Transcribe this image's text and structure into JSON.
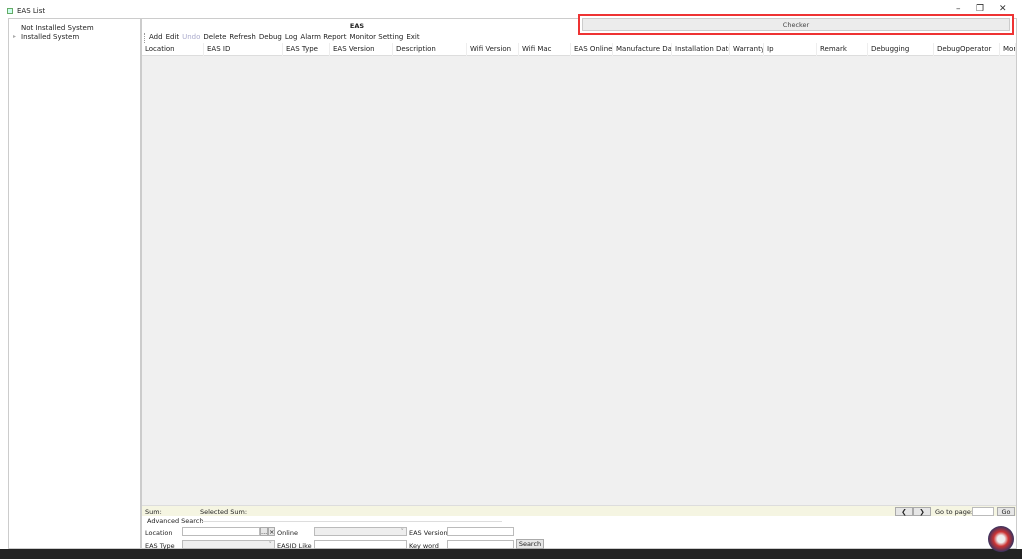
{
  "window": {
    "title": "EAS List",
    "minimize": "–",
    "restore": "❐",
    "close": "✕"
  },
  "tree": {
    "items": [
      {
        "label": "Not Installed System"
      },
      {
        "label": "Installed System",
        "expander": "▸"
      }
    ]
  },
  "main": {
    "title": "EAS",
    "checker_label": "Checker",
    "toolbar": [
      "Add",
      "Edit",
      "Undo",
      "Delete",
      "Refresh",
      "Debug",
      "Log",
      "Alarm Report",
      "Monitor Setting",
      "Exit"
    ],
    "columns": [
      "Location",
      "EAS ID",
      "EAS Type",
      "EAS Version",
      "Description",
      "Wifi Version",
      "Wifi Mac",
      "EAS Online",
      "Manufacture Date",
      "Installation Date",
      "Warranty",
      "Ip",
      "Remark",
      "Debugging",
      "DebugOperator",
      "Mor"
    ]
  },
  "status": {
    "sum": "Sum:",
    "selected_sum": "Selected Sum:",
    "prev": "❮",
    "next": "❯",
    "goto_label": "Go to page:",
    "go": "Go",
    "goto_value": ""
  },
  "search": {
    "title": "Advanced Search",
    "location": "Location",
    "online": "Online",
    "eas_version": "EAS Version",
    "eas_type": "EAS Type",
    "easid_like": "EASID Like",
    "keyword": "Key word",
    "search_button": "Search",
    "browse": "...",
    "clear": "×",
    "dropdown": "˅"
  }
}
